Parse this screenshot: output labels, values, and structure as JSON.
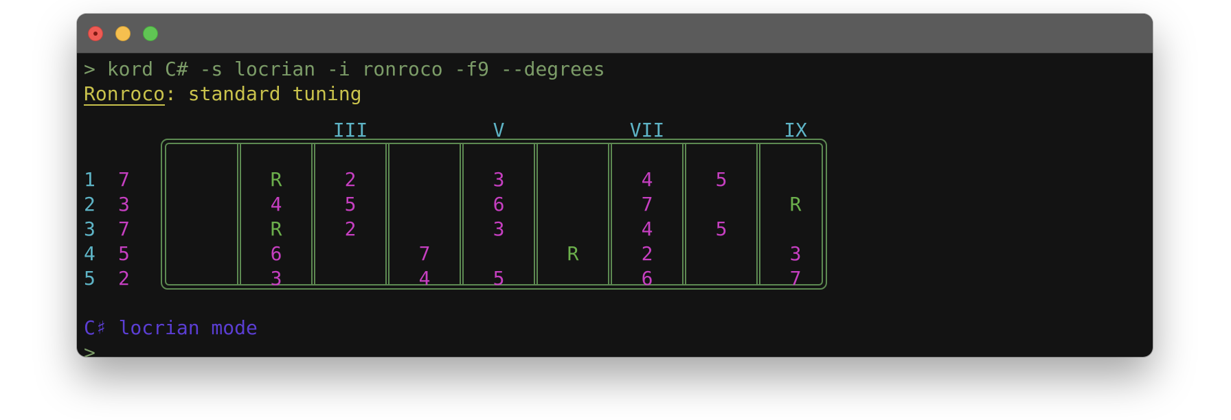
{
  "window": {
    "controls": [
      "close",
      "minimize",
      "zoom"
    ]
  },
  "terminal": {
    "command_line": "> kord C# -s locrian -i ronroco -f9 --degrees",
    "instrument": "Ronroco",
    "tuning_suffix": ": standard tuning",
    "mode_line": "C♯ locrian mode",
    "prompt": ">"
  },
  "fret_markers": [
    {
      "fret": 3,
      "label": "III"
    },
    {
      "fret": 5,
      "label": "V"
    },
    {
      "fret": 7,
      "label": "VII"
    },
    {
      "fret": 9,
      "label": "IX"
    }
  ],
  "strings": [
    {
      "number": "1",
      "open": "7",
      "frets": [
        "",
        "R",
        "2",
        "",
        "3",
        "",
        "4",
        "5",
        ""
      ]
    },
    {
      "number": "2",
      "open": "3",
      "frets": [
        "",
        "4",
        "5",
        "",
        "6",
        "",
        "7",
        "",
        "R"
      ]
    },
    {
      "number": "3",
      "open": "7",
      "frets": [
        "",
        "R",
        "2",
        "",
        "3",
        "",
        "4",
        "5",
        ""
      ]
    },
    {
      "number": "4",
      "open": "5",
      "frets": [
        "",
        "6",
        "",
        "7",
        "",
        "R",
        "2",
        "",
        "3"
      ]
    },
    {
      "number": "5",
      "open": "2",
      "frets": [
        "",
        "3",
        "",
        "4",
        "5",
        "",
        "6",
        "",
        "7"
      ]
    }
  ],
  "colors": {
    "background": "#131313",
    "command": "#7c9c68",
    "tuning": "#c9c24c",
    "string_number": "#5eb4c6",
    "degree": "#c63fc1",
    "root": "#6cb04c",
    "fretboard": "#5d8a52",
    "mode": "#5b3ed3"
  }
}
